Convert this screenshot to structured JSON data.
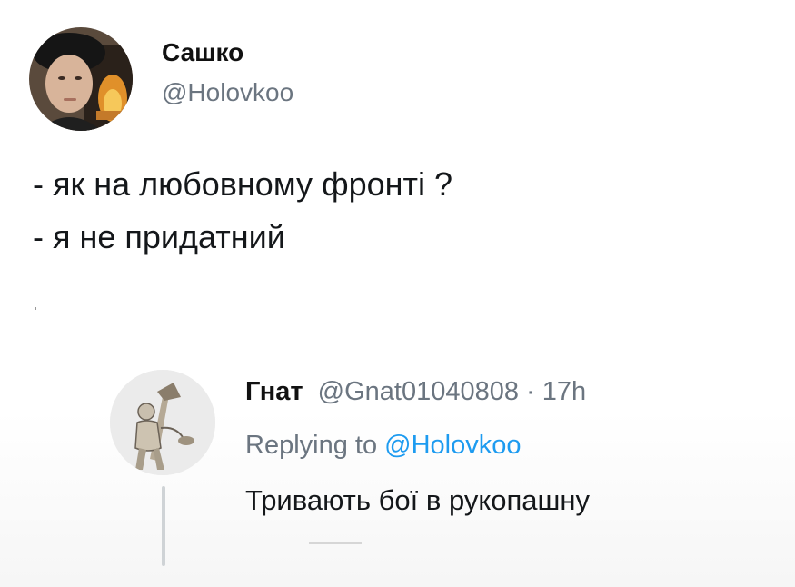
{
  "tweet": {
    "display_name": "Сашко",
    "handle": "@Holovkoo",
    "lines": [
      "- як на любовному фронті ?",
      "- я не придатний"
    ]
  },
  "reply": {
    "display_name": "Гнат",
    "handle": "@Gnat01040808",
    "separator": "·",
    "time": "17h",
    "replying_prefix": "Replying to",
    "replying_handle": "@Holovkoo",
    "text": "Тривають бої в рукопашну"
  },
  "colors": {
    "text": "#14171a",
    "secondary": "#6b7580",
    "link": "#1d9bf0",
    "thread_line": "#cfd3d6"
  },
  "icons": {
    "main_avatar": "profile-photo-avatar",
    "reply_avatar": "engraving-avatar"
  }
}
